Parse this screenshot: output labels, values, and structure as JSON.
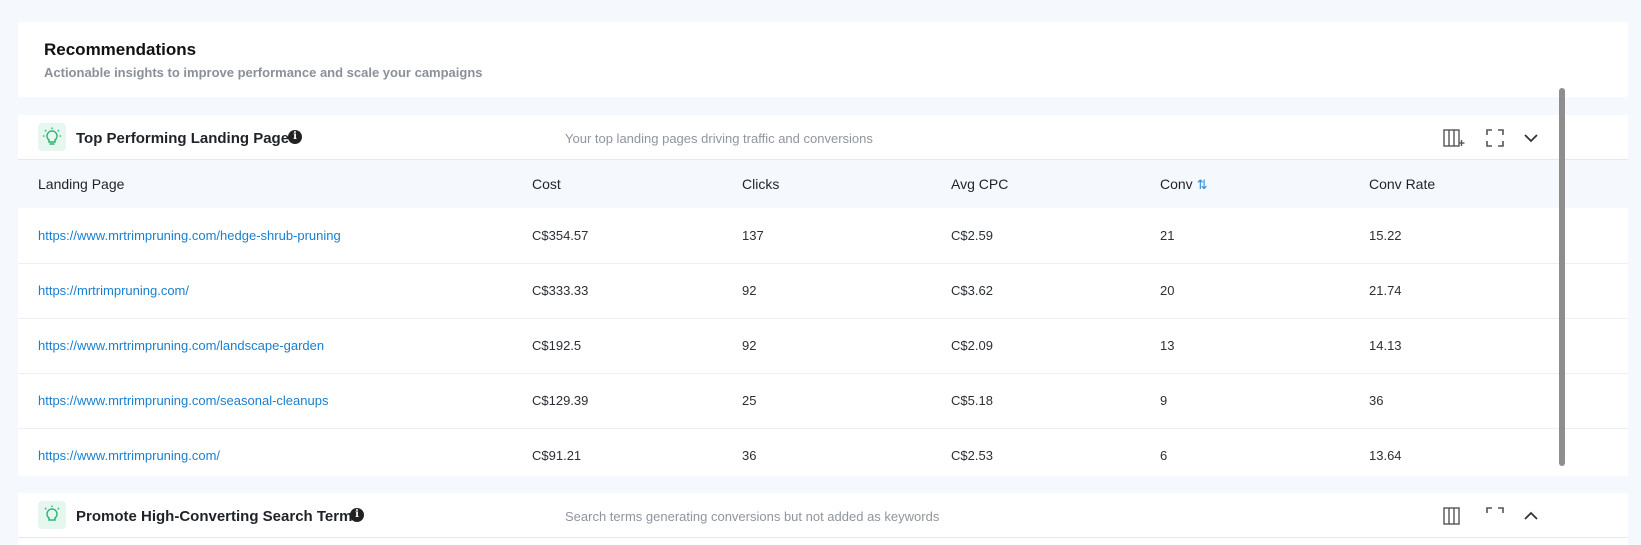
{
  "recommendations": {
    "title": "Recommendations",
    "subtitle": "Actionable insights to improve performance and scale your campaigns"
  },
  "top_panel": {
    "title": "Top Performing Landing Pages",
    "info": "i",
    "description": "Your top landing pages driving traffic and conversions",
    "icons": [
      "columns-add-icon",
      "fullscreen-icon",
      "chevron-down-icon"
    ],
    "columns": [
      "Landing Page",
      "Cost",
      "Clicks",
      "Avg CPC",
      "Conv",
      "Conv Rate"
    ],
    "sort_icon": "⇅",
    "rows": [
      [
        "https://www.mrtrimpruning.com/hedge-shrub-pruning",
        "C$354.57",
        "137",
        "C$2.59",
        "21",
        "15.22"
      ],
      [
        "https://mrtrimpruning.com/",
        "C$333.33",
        "92",
        "C$3.62",
        "20",
        "21.74"
      ],
      [
        "https://www.mrtrimpruning.com/landscape-garden",
        "C$192.5",
        "92",
        "C$2.09",
        "13",
        "14.13"
      ],
      [
        "https://www.mrtrimpruning.com/seasonal-cleanups",
        "C$129.39",
        "25",
        "C$5.18",
        "9",
        "36"
      ],
      [
        "https://www.mrtrimpruning.com/",
        "C$91.21",
        "36",
        "C$2.53",
        "6",
        "13.64"
      ]
    ]
  },
  "second_panel": {
    "title": "Promote High-Converting Search Terms",
    "info": "i",
    "description": "Search terms generating conversions but not added as keywords",
    "icons": [
      "columns-add-icon",
      "fullscreen-icon",
      "chevron-up-icon"
    ]
  },
  "colors": {
    "link": "#1a7fd0",
    "accent_green": "#2bb673",
    "page_bg": "#f5f8fd"
  }
}
